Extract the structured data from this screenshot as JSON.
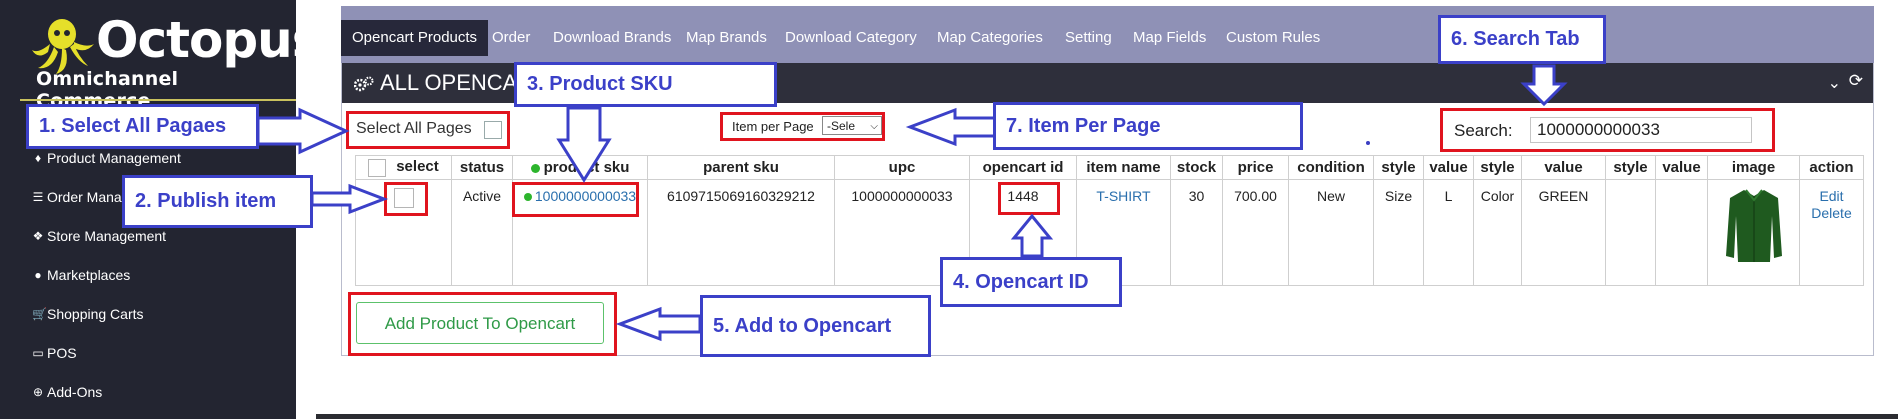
{
  "brand": {
    "name": "Octopus",
    "tagline": "Omnichannel Commerce"
  },
  "sidebar": {
    "items": [
      {
        "label": "Product Management",
        "icon": "tag-icon"
      },
      {
        "label": "Order Manag",
        "icon": "database-icon"
      },
      {
        "label": "Store Management",
        "icon": "cubes-icon"
      },
      {
        "label": "Marketplaces",
        "icon": "globe-icon"
      },
      {
        "label": "Shopping Carts",
        "icon": "cart-icon"
      },
      {
        "label": "POS",
        "icon": "laptop-icon"
      },
      {
        "label": "Add-Ons",
        "icon": "plus-circle-icon"
      }
    ]
  },
  "nav": {
    "tabs": [
      {
        "label": "Opencart Products",
        "active": true
      },
      {
        "label": "Order"
      },
      {
        "label": "Download Brands"
      },
      {
        "label": "Map Brands"
      },
      {
        "label": "Download Category"
      },
      {
        "label": "Map Categories"
      },
      {
        "label": "Setting"
      },
      {
        "label": "Map Fields"
      },
      {
        "label": "Custom Rules"
      }
    ]
  },
  "header": {
    "title": "ALL OPENCA"
  },
  "controls": {
    "select_all_label": "Select All Pages",
    "items_per_page_label": "Item per Page",
    "items_per_page_value": "-Sele",
    "search_label": "Search:",
    "search_value": "1000000000033"
  },
  "table": {
    "headers": [
      "select",
      "status",
      "product sku",
      "parent sku",
      "upc",
      "opencart id",
      "item name",
      "stock",
      "price",
      "condition",
      "style",
      "value",
      "style",
      "value",
      "style",
      "value",
      "image",
      "action"
    ],
    "rows": [
      {
        "status": "Active",
        "product_sku": "1000000000033",
        "parent_sku": "6109715069160329212",
        "upc": "1000000000033",
        "opencart_id": "1448",
        "item_name": "T-SHIRT",
        "stock": "30",
        "price": "700.00",
        "condition": "New",
        "style1": "Size",
        "value1": "L",
        "style2": "Color",
        "value2": "GREEN",
        "style3": "",
        "value3": "",
        "action_edit": "Edit",
        "action_delete": "Delete"
      }
    ]
  },
  "add_button_label": "Add Product To Opencart",
  "annotations": {
    "c1": "1. Select All Pagaes",
    "c2": "2. Publish item",
    "c3": "3. Product SKU",
    "c4": "4. Opencart ID",
    "c5": "5. Add to Opencart",
    "c6": "6. Search Tab",
    "c7": "7. Item Per Page"
  },
  "colors": {
    "annotation": "#3b40c8",
    "highlight": "#e0141e",
    "sidebar": "#232531",
    "nav": "#8f91b6"
  }
}
